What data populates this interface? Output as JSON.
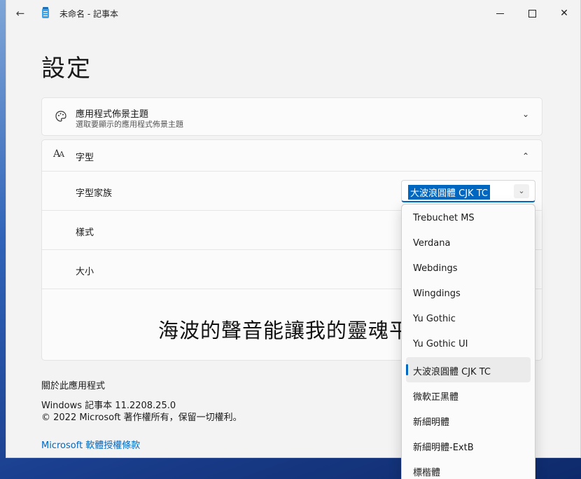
{
  "window": {
    "title": "未命名 - 記事本",
    "back_icon": "arrow-left-icon",
    "minimize_icon": "minimize-icon",
    "maximize_icon": "maximize-icon",
    "close_icon": "close-icon"
  },
  "page": {
    "title": "設定"
  },
  "theme_card": {
    "title": "應用程式佈景主題",
    "subtitle": "選取要顯示的應用程式佈景主題",
    "icon": "palette-icon",
    "expanded": false
  },
  "font_card": {
    "title": "字型",
    "icon": "font-aa-icon",
    "expanded": true,
    "family_label": "字型家族",
    "family_value": "大波浪圓體 CJK TC",
    "style_label": "樣式",
    "size_label": "大小",
    "preview_text": "海波的聲音能讓我的靈魂平靜"
  },
  "font_dropdown": {
    "items": [
      "Trebuchet MS",
      "Verdana",
      "Webdings",
      "Wingdings",
      "Yu Gothic",
      "Yu Gothic UI",
      "大波浪圓體 CJK TC",
      "微軟正黑體",
      "新細明體",
      "新細明體-ExtB",
      "標楷體"
    ],
    "selected_index": 6
  },
  "about": {
    "title": "關於此應用程式",
    "version": "Windows 記事本 11.2208.25.0",
    "copyright": "© 2022 Microsoft 著作權所有，保留一切權利。",
    "license_link": "Microsoft 軟體授權條款"
  },
  "colors": {
    "accent": "#0067c0",
    "background": "#f3f3f3",
    "card": "#fbfbfb"
  }
}
